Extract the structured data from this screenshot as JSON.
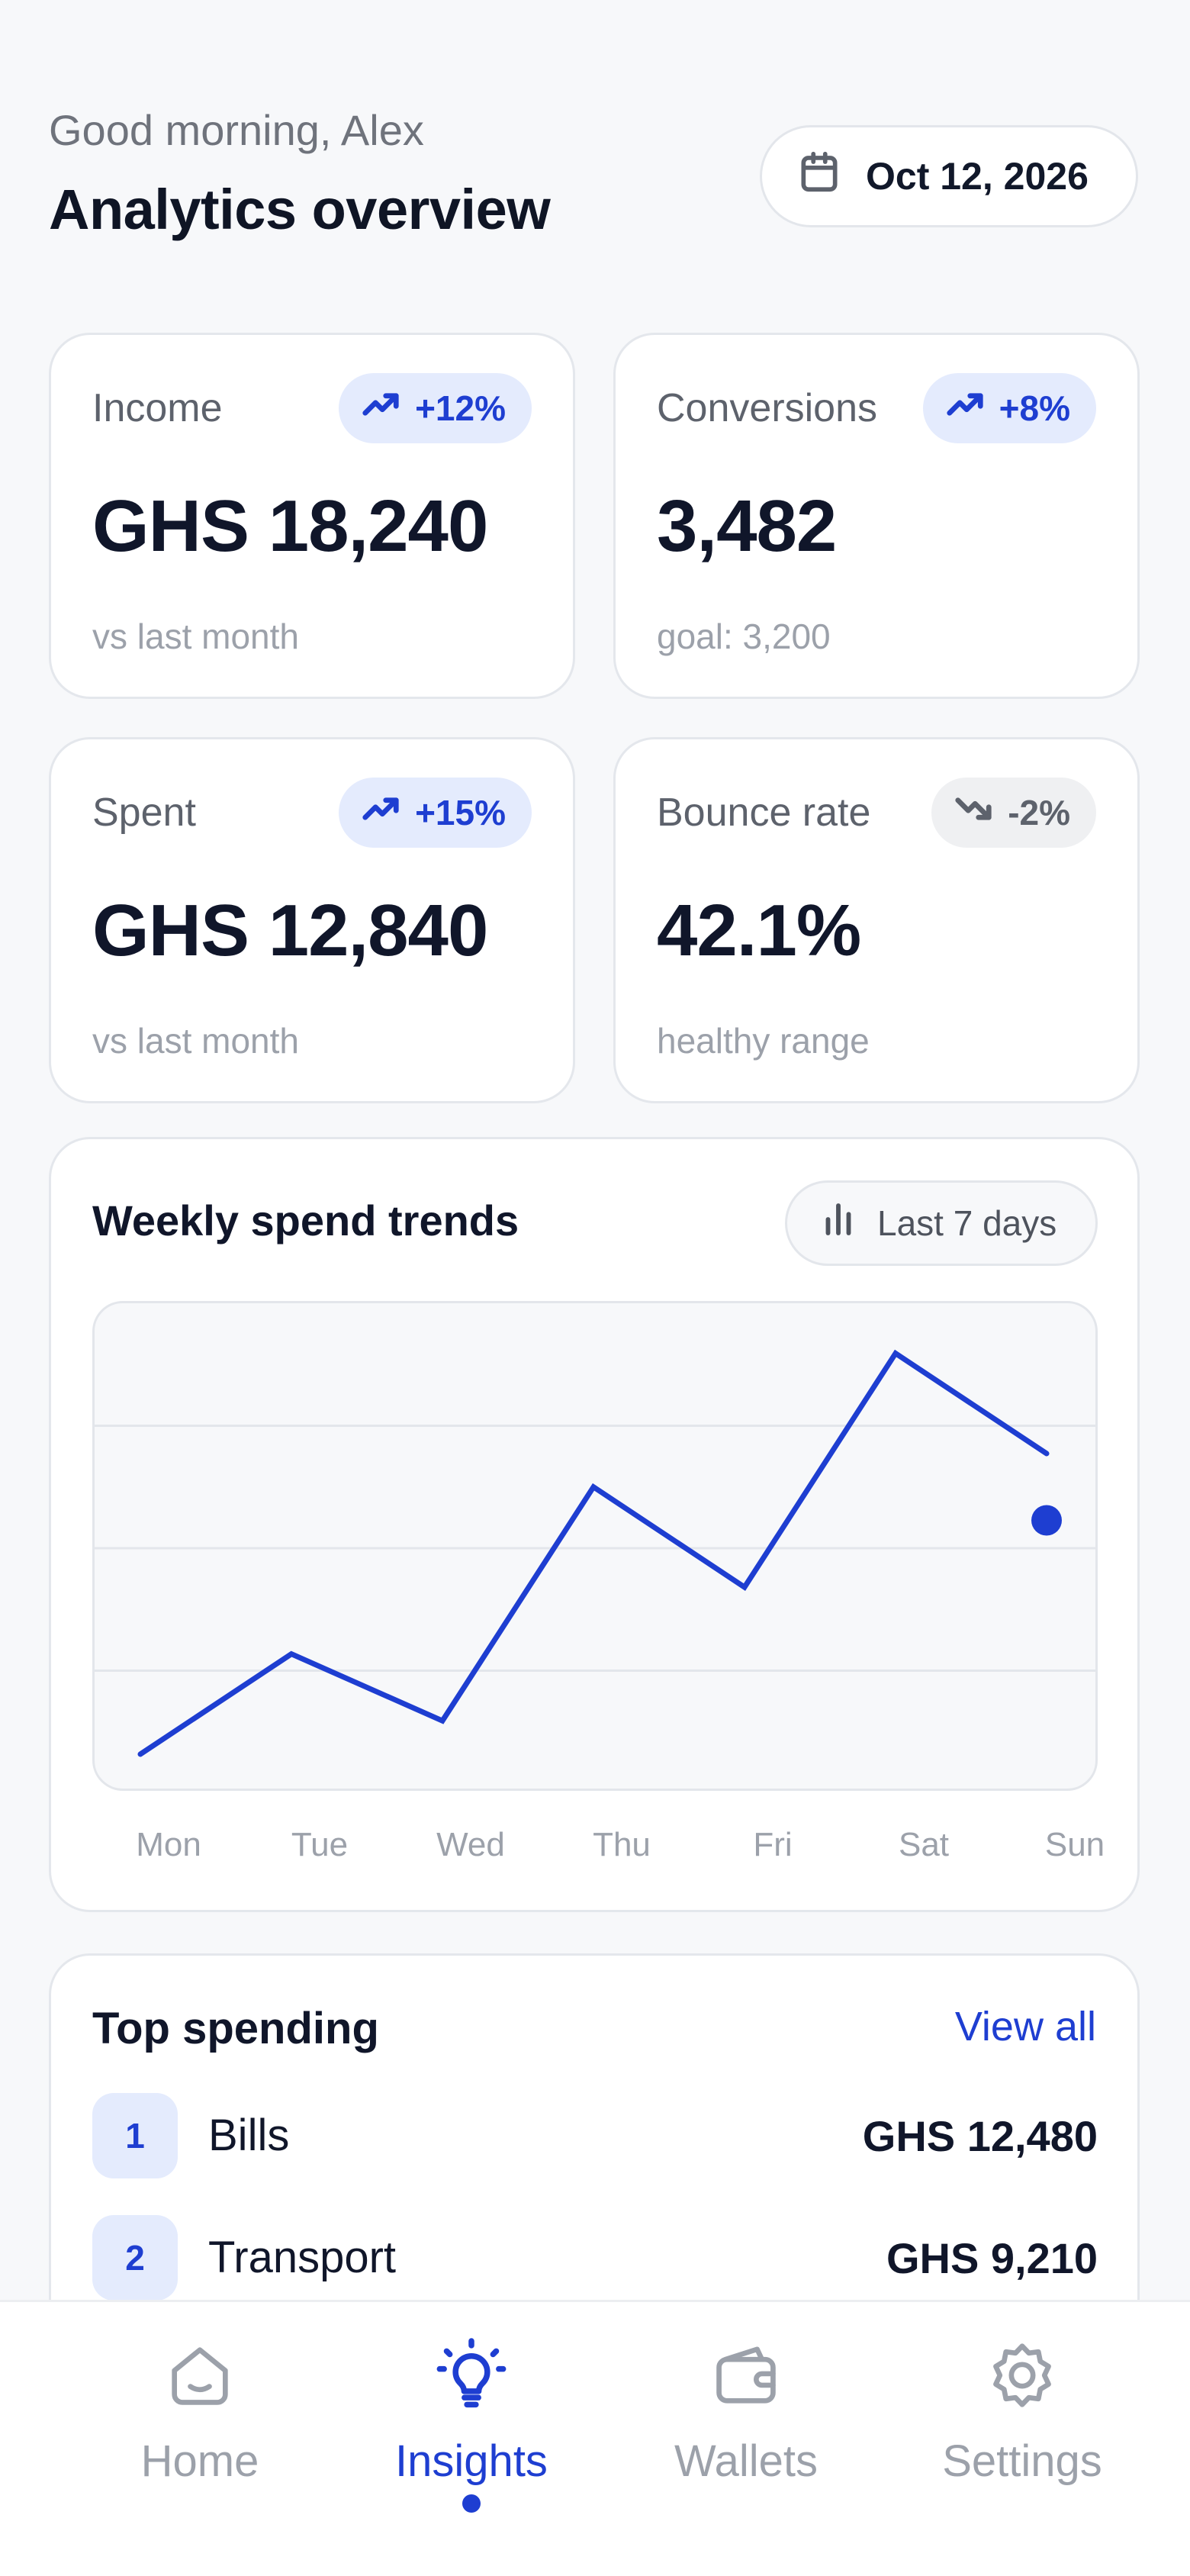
{
  "header": {
    "greeting": "Good morning, Alex",
    "title": "Analytics overview",
    "date": "Oct 12, 2026",
    "date_icon": "calendar-icon"
  },
  "stats": [
    {
      "label": "Income",
      "badge": "+12%",
      "trend": "up",
      "value": "GHS 18,240",
      "sub": "vs last month"
    },
    {
      "label": "Conversions",
      "badge": "+8%",
      "trend": "up",
      "value": "3,482",
      "sub": "goal: 3,200"
    },
    {
      "label": "Spent",
      "badge": "+15%",
      "trend": "up",
      "value": "GHS 12,840",
      "sub": "vs last month"
    },
    {
      "label": "Bounce rate",
      "badge": "-2%",
      "trend": "down",
      "value": "42.1%",
      "sub": "healthy range"
    }
  ],
  "chart_card": {
    "title": "Weekly spend trends",
    "range_label": "Last 7 days",
    "range_icon": "bar-chart-icon"
  },
  "chart_data": {
    "type": "line",
    "title": "Weekly spend trends",
    "categories": [
      "Mon",
      "Tue",
      "Wed",
      "Thu",
      "Fri",
      "Sat",
      "Sun"
    ],
    "series": [
      {
        "values": [
          7,
          25,
          13,
          55,
          37,
          79,
          61
        ]
      }
    ],
    "highlight_point": {
      "category": "Sun",
      "value": 49
    },
    "ylim": [
      0,
      88
    ],
    "grid": true,
    "line_color": "#1e3ed1"
  },
  "top_spending": {
    "title": "Top spending",
    "view_all": "View all",
    "items": [
      {
        "rank": "1",
        "name": "Bills",
        "amount": "GHS 12,480"
      },
      {
        "rank": "2",
        "name": "Transport",
        "amount": "GHS 9,210"
      }
    ]
  },
  "nav": {
    "items": [
      {
        "label": "Home",
        "icon": "home-icon",
        "active": false
      },
      {
        "label": "Insights",
        "icon": "lightbulb-icon",
        "active": true
      },
      {
        "label": "Wallets",
        "icon": "wallet-icon",
        "active": false
      },
      {
        "label": "Settings",
        "icon": "gear-icon",
        "active": false
      }
    ]
  },
  "colors": {
    "accent": "#1e3ed1",
    "badge_bg": "#e4ebfd",
    "background": "#f7f8fa",
    "muted_text": "#9ca1aa"
  }
}
